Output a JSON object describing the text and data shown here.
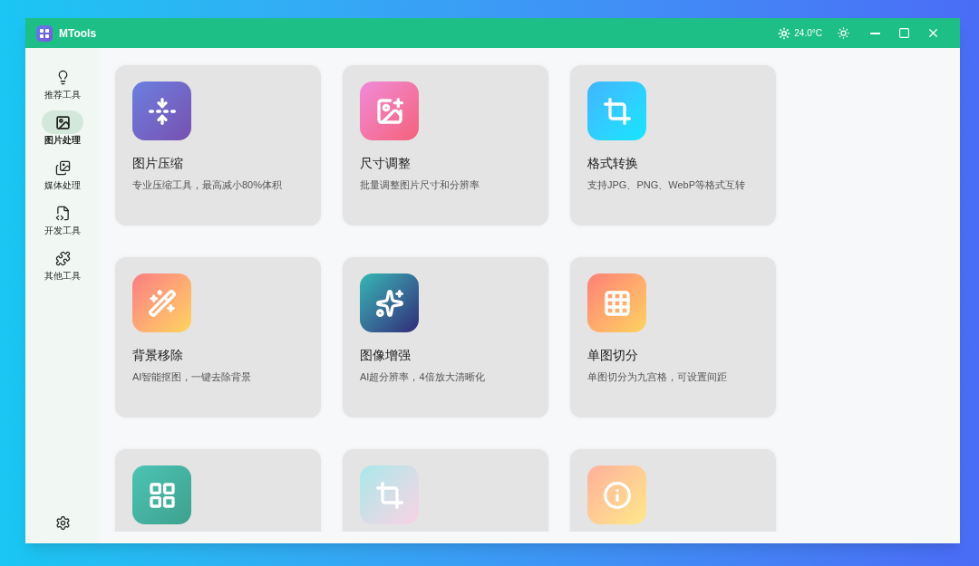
{
  "window": {
    "title": "MTools",
    "weather": "24.0°C"
  },
  "sidebar": {
    "items": [
      {
        "kind": "recommend",
        "label": "推荐工具",
        "selected": false
      },
      {
        "kind": "image",
        "label": "图片处理",
        "selected": true
      },
      {
        "kind": "media",
        "label": "媒体处理",
        "selected": false
      },
      {
        "kind": "dev",
        "label": "开发工具",
        "selected": false
      },
      {
        "kind": "other",
        "label": "其他工具",
        "selected": false
      }
    ]
  },
  "cards": [
    {
      "kind": "compress",
      "title": "图片压缩",
      "description": "专业压缩工具，最高减小80%体积"
    },
    {
      "kind": "resize",
      "title": "尺寸调整",
      "description": "批量调整图片尺寸和分辨率"
    },
    {
      "kind": "convert",
      "title": "格式转换",
      "description": "支持JPG、PNG、WebP等格式互转"
    },
    {
      "kind": "remove-bg",
      "title": "背景移除",
      "description": "AI智能抠图，一键去除背景"
    },
    {
      "kind": "enhance",
      "title": "图像增强",
      "description": "AI超分辨率，4倍放大清晰化"
    },
    {
      "kind": "split",
      "title": "单图切分",
      "description": "单图切分为九宫格，可设置间距"
    },
    {
      "kind": "grid"
    },
    {
      "kind": "crop"
    },
    {
      "kind": "info"
    }
  ]
}
